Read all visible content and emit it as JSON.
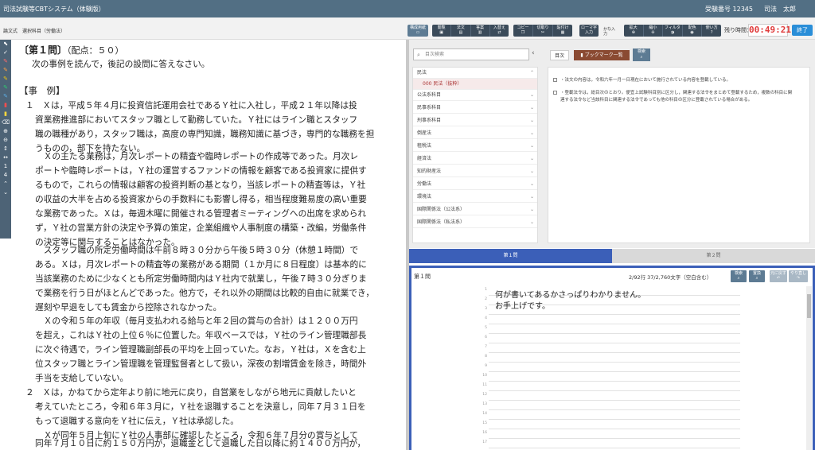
{
  "titlebar": {
    "title": "司法試験等CBTシステム（体験版）",
    "exam_number": "受験番号 12345",
    "user": "司法　太郎"
  },
  "toolbar": {
    "subject": "論文式　選択科目（労働法）",
    "groups": [
      [
        "構成用紙"
      ],
      [
        "閲覧",
        "法文",
        "答案",
        "入替え"
      ],
      [
        "コピー",
        "切取り",
        "貼付け"
      ],
      [
        "ローマ字入力"
      ],
      [
        "拡大",
        "縮小",
        "フィルタ",
        "配色",
        "使い方"
      ]
    ],
    "kana_label": "かな入力",
    "time_label": "残り時間：",
    "time_remaining": "00:49:21",
    "end_label": "終了"
  },
  "question": {
    "title": "〔第１問〕",
    "score": "（配点：５０）",
    "lines": [
      "次の事例を読んで，後記の設問に答えなさい。",
      "【事　例】",
      "１　Ｘは，平成５年４月に投資信託運用会社であるＹ社に入社し，平成２１年以降は投",
      "資業務推進部においてスタッフ職として勤務していた。Ｙ社にはライン職とスタッフ",
      "職の職種があり，スタッフ職は，高度の専門知識，職務知識に基づき，専門的な職務を担",
      "うものの，部下を持たない。",
      "　Ｘの主たる業務は，月次レポートの精査や臨時レポートの作成等であった。月次レ",
      "ポートや臨時レポートは，Ｙ社の運営するファンドの情報を顧客である投資家に提供す",
      "るもので，これらの情報は顧客の投資判断の基となり，当該レポートの精査等は，Ｙ社",
      "の収益の大半を占める投資家からの手数料にも影響し得る，相当程度難易度の高い重要",
      "な業務であった。Ｘは，毎週木曜に開催される管理者ミーティングへの出席を求められ",
      "ず，Ｙ社の営業方針の決定や予算の策定，企業組織や人事制度の構築・改編，労働条件",
      "の決定等に関与することはなかった。",
      "　スタッフ職の所定労働時間は午前８時３０分から午後５時３０分（休憩１時間）で",
      "ある。Ｘは，月次レポートの精査等の業務がある期間（１か月に８日程度）は基本的に",
      "当該業務のために少なくとも所定労働時間内はＹ社内で就業し，午後７時３０分ぎりま",
      "で業務を行う日がほとんどであった。他方で，それ以外の期間は比較的自由に就業でき，",
      "遅刻や早退をしても賃金から控除されなかった。",
      "　Ｘの令和５年の年収（毎月支払われる給与と年２回の賞与の合計）は１２００万円",
      "を超え，これはＹ社の上位６％に位置した。年収ベースでは，Ｙ社のライン管理職部長",
      "に次ぐ待遇で，ライン管理職副部長の平均を上回っていた。なお，Ｙ社は，Ｘを含む上",
      "位スタッフ職とライン管理職を管理監督者として扱い，深夜の割増賃金を除き，時間外",
      "手当を支給していない。",
      "２　Ｘは，かねてから定年より前に地元に戻り，自営業をしながら地元に貢献したいと",
      "考えていたところ，令和６年３月に，Ｙ社を退職することを決意し，同年７月３１日を",
      "もって退職する意向をＹ社に伝え，Ｙ社は承認した。",
      "　Ｘが同年５月上旬にＹ社の人事部に確認したところ，令和６年７月分の賞与として",
      "同年７月１０日に約１５０万円が，退職金として退職した日以降に約１４００万円が，"
    ]
  },
  "law": {
    "search_placeholder": "目次検索",
    "toc_tab": "目次",
    "bookmark_tab": "ブックマーク一覧",
    "search_btn": "検索",
    "items": [
      "民法",
      "000 民法（抜粋）",
      "公法系科目",
      "民事系科目",
      "刑事系科目",
      "倒産法",
      "租税法",
      "経済法",
      "知的財産法",
      "労働法",
      "環境法",
      "国際関係法（公法系）",
      "国際関係法（私法系）"
    ],
    "notes": [
      "・法文の内容は，令和六年一月一日現在において施行されている内容を登載している。",
      "・登載法令は，総目次のとおり。便宜上試験科目別に区分し，関連する法令をまとめて登載するため，複数の科目に関",
      "連する法令など当該科目に関連する法令であっても他の科目の区分に登載されている場合がある。"
    ]
  },
  "answer": {
    "tab1": "第１問",
    "tab2": "第２問",
    "label": "第１問",
    "info": "2/92行  37/2,760文字（空白含む）",
    "buttons": [
      "検索",
      "置換",
      "元に戻す",
      "やり直し"
    ],
    "lines": [
      "何が書いてあるかさっぱりわかりません。",
      "お手上げです。"
    ]
  }
}
